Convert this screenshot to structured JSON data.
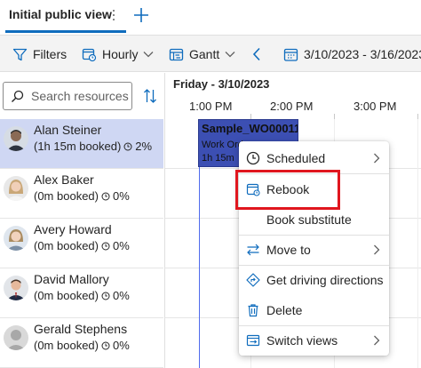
{
  "tabs": {
    "active_label": "Initial public view"
  },
  "toolbar": {
    "filters_label": "Filters",
    "hourly_label": "Hourly",
    "gantt_label": "Gantt",
    "date_range": "3/10/2023 - 3/16/2023"
  },
  "search": {
    "placeholder": "Search resources"
  },
  "resources": [
    {
      "name": "Alan Steiner",
      "booked": "(1h 15m booked)",
      "pct": "2%"
    },
    {
      "name": "Alex Baker",
      "booked": "(0m booked)",
      "pct": "0%"
    },
    {
      "name": "Avery Howard",
      "booked": "(0m booked)",
      "pct": "0%"
    },
    {
      "name": "David Mallory",
      "booked": "(0m booked)",
      "pct": "0%"
    },
    {
      "name": "Gerald Stephens",
      "booked": "(0m booked)",
      "pct": "0%"
    }
  ],
  "gantt": {
    "date_label": "Friday - 3/10/2023",
    "times": [
      "1:00 PM",
      "2:00 PM",
      "3:00 PM"
    ]
  },
  "booking": {
    "title": "Sample_WO00011",
    "subtitle": "Work Order",
    "duration": "1h 15m"
  },
  "menu": {
    "scheduled": "Scheduled",
    "rebook": "Rebook",
    "book_substitute": "Book substitute",
    "move_to": "Move to",
    "driving_directions": "Get driving directions",
    "delete": "Delete",
    "switch_views": "Switch views"
  },
  "colors": {
    "accent": "#0f6cbd",
    "selected_row": "#cfd7f3",
    "booking": "#3c4fb3",
    "highlight": "#e0161e"
  }
}
